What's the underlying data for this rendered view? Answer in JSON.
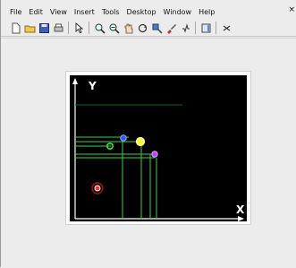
{
  "menubar": {
    "items": [
      "File",
      "Edit",
      "View",
      "Insert",
      "Tools",
      "Desktop",
      "Window",
      "Help"
    ],
    "close_glyph": "×"
  },
  "toolbar": {
    "buttons": [
      "new-file-icon",
      "open-folder-icon",
      "save-icon",
      "print-icon",
      "pointer-icon",
      "zoom-in-icon",
      "zoom-out-icon",
      "pan-icon",
      "rotate-3d-icon",
      "data-cursor-icon",
      "brush-icon",
      "link-icon",
      "colorbar-icon",
      "legend-icon"
    ]
  },
  "axes": {
    "y_label": "Y",
    "x_label": "X"
  },
  "colors": {
    "plot_background": "#000000",
    "guide_lines": "#3ecf3e",
    "point_blue": "#3a50ff",
    "point_yellow": "#ffff40",
    "point_purple": "#c040ff",
    "point_green": "#40e040",
    "point_red": "#ff3030"
  }
}
